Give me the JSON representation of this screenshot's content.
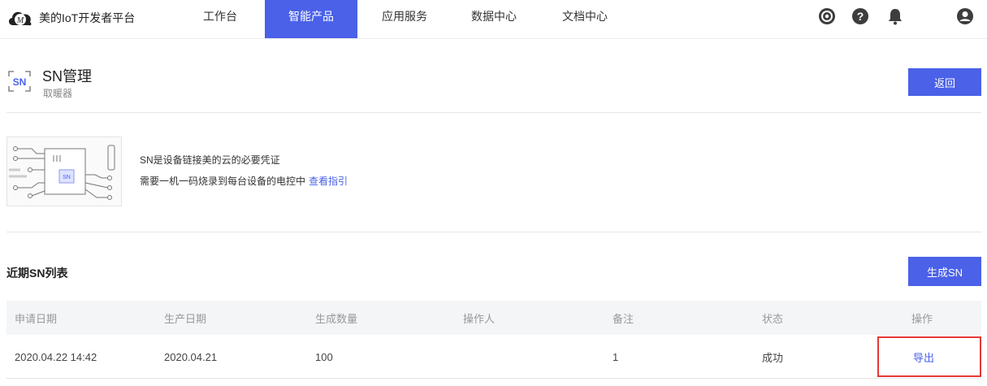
{
  "nav": {
    "brand": "美的IoT开发者平台",
    "items": [
      {
        "label": "工作台",
        "active": false
      },
      {
        "label": "智能产品",
        "active": true
      },
      {
        "label": "应用服务",
        "active": false
      },
      {
        "label": "数据中心",
        "active": false
      },
      {
        "label": "文档中心",
        "active": false
      }
    ],
    "icons": [
      "target-icon",
      "help-icon",
      "bell-icon",
      "user-icon"
    ]
  },
  "header": {
    "icon_text": "SN",
    "title": "SN管理",
    "subtitle": "取暖器",
    "back_button": "返回"
  },
  "info": {
    "chip_label": "SN",
    "line1": "SN是设备链接美的云的必要凭证",
    "line2": "需要一机一码烧录到每台设备的电控中",
    "guide_link": "查看指引"
  },
  "list": {
    "title": "近期SN列表",
    "generate_button": "生成SN",
    "columns": [
      "申请日期",
      "生产日期",
      "生成数量",
      "操作人",
      "备注",
      "状态",
      "操作"
    ],
    "rows": [
      {
        "apply_date": "2020.04.22 14:42",
        "production_date": "2020.04.21",
        "quantity": "100",
        "operator": "",
        "remark": "1",
        "status": "成功",
        "action": "导出"
      }
    ]
  },
  "colors": {
    "accent": "#4a61e8",
    "highlight": "#e53935"
  }
}
